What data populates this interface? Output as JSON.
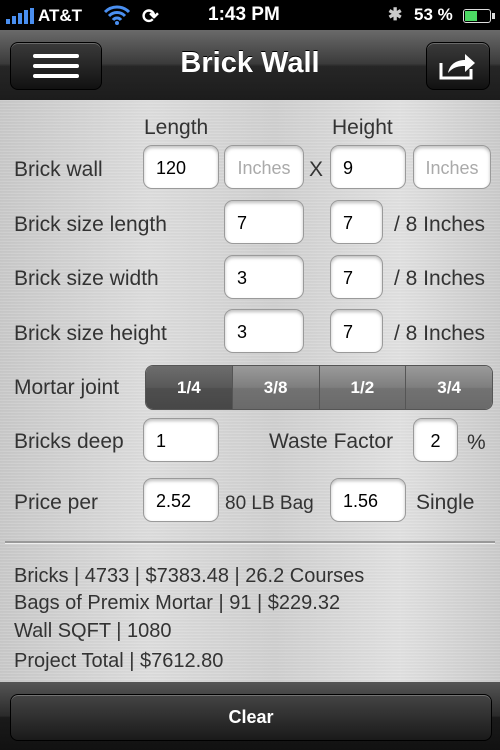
{
  "status": {
    "carrier": "AT&T",
    "time": "1:43 PM",
    "battery": "53 %",
    "battery_level": 0.53
  },
  "nav": {
    "title": "Brick Wall",
    "menu_icon": "hamburger-icon",
    "share_icon": "share-icon"
  },
  "headers": {
    "length": "Length",
    "height": "Height"
  },
  "wall": {
    "label": "Brick wall",
    "length_value": "120",
    "length_unit_placeholder": "Inches",
    "times": "X",
    "height_value": "9",
    "height_unit_placeholder": "Inches"
  },
  "brick_length": {
    "label": "Brick size length",
    "whole": "7",
    "fraction": "7",
    "suffix": "/ 8 Inches"
  },
  "brick_width": {
    "label": "Brick size width",
    "whole": "3",
    "fraction": "7",
    "suffix": "/ 8 Inches"
  },
  "brick_height": {
    "label": "Brick size height",
    "whole": "3",
    "fraction": "7",
    "suffix": "/ 8 Inches"
  },
  "mortar": {
    "label": "Mortar joint",
    "options": [
      "1/4",
      "3/8",
      "1/2",
      "3/4"
    ],
    "selected": "1/4"
  },
  "bricks_deep": {
    "label": "Bricks deep",
    "value": "1"
  },
  "waste": {
    "label": "Waste Factor",
    "value": "2",
    "unit": "%"
  },
  "price": {
    "label": "Price per",
    "bag_value": "2.52",
    "bag_label": "80 LB Bag",
    "single_value": "1.56",
    "single_label": "Single"
  },
  "results": [
    "Bricks | 4733 | $7383.48 | 26.2 Courses",
    "Bags of Premix Mortar | 91 | $229.32",
    "Wall SQFT | 1080",
    "Project Total | $7612.80"
  ],
  "clear_label": "Clear"
}
